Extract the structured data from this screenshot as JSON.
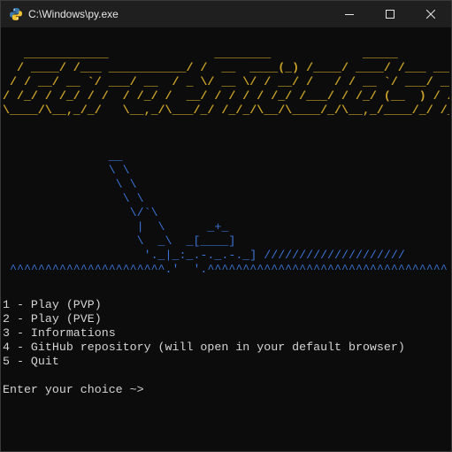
{
  "window": {
    "title": "C:\\Windows\\py.exe",
    "icon": "python-icon",
    "controls": [
      "minimize-icon",
      "maximize-icon",
      "close-icon"
    ]
  },
  "console": {
    "logo": "   ____________               ________             _____                _   \n  / ____/ /___ ___________/ /  __  ____(_) /____/ ____/ /___ ____/ /_  \n / / __/ __ `/ ___/ __  / _ \\/ __ \\/ / __/ /   / / __ `/ ___/ __ \\ \n/ /_/ / /_/ / /  / /_/ /  __/ / / / / /_/ /___/ / /_/ (__  ) / / / \n\\____/\\__,_/_/   \\__,_/\\___/_/ /_/_/\\__/\\____/_/\\__,_/____/_/ /_/  ",
    "mower": "               __\n               \\ \\\n                \\ \\\n                 \\ \\\n                  \\/`\\\n                   |  \\      _+_\n                   \\  _\\  _[____]\n                    '._|_:_.-._.-._] ////////////////////\n ^^^^^^^^^^^^^^^^^^^^^^.'  '.^^^^^^^^^^^^^^^^^^^^^^^^^^^^^^^^^^",
    "menu": [
      "1 - Play (PVP)",
      "2 - Play (PVE)",
      "3 - Informations",
      "4 - GitHub repository (will open in your default browser)",
      "5 - Quit"
    ],
    "prompt": "Enter your choice ~>"
  },
  "colors": {
    "background": "#0c0c0c",
    "titlebar": "#1f1f1f",
    "logo": "#c9a227",
    "mower": "#3c74d6",
    "text": "#d4d4d4"
  }
}
